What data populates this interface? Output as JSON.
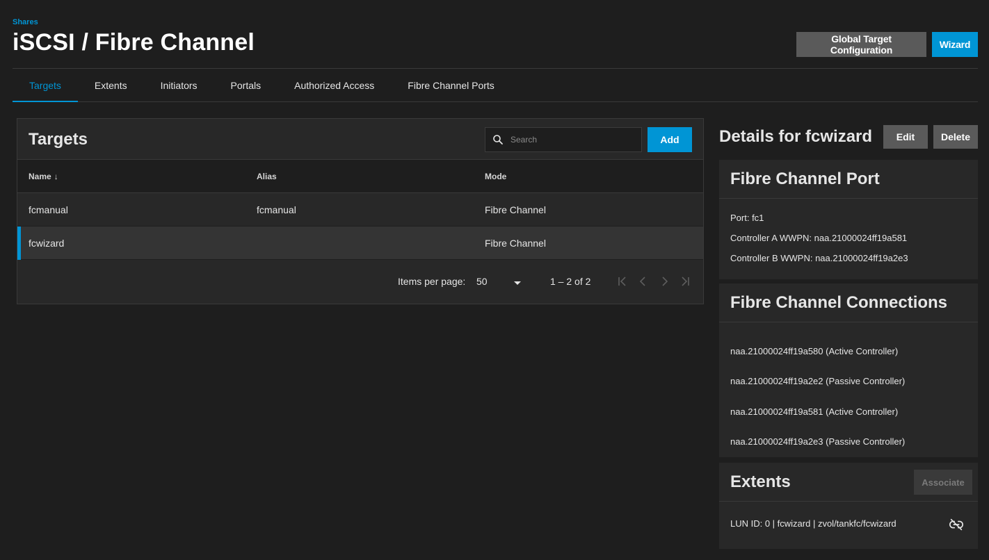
{
  "header": {
    "breadcrumb": "Shares",
    "title": "iSCSI / Fibre Channel",
    "global_target_label": "Global Target Configuration",
    "wizard_label": "Wizard"
  },
  "tabs": [
    {
      "label": "Targets",
      "active": true
    },
    {
      "label": "Extents"
    },
    {
      "label": "Initiators"
    },
    {
      "label": "Portals"
    },
    {
      "label": "Authorized Access"
    },
    {
      "label": "Fibre Channel Ports"
    }
  ],
  "targets_card": {
    "title": "Targets",
    "search_placeholder": "Search",
    "add_label": "Add",
    "columns": [
      "Name",
      "Alias",
      "Mode"
    ],
    "rows": [
      {
        "name": "fcmanual",
        "alias": "fcmanual",
        "mode": "Fibre Channel"
      },
      {
        "name": "fcwizard",
        "alias": "",
        "mode": "Fibre Channel",
        "selected": true
      }
    ],
    "paginator": {
      "items_per_page_label": "Items per page:",
      "page_size": "50",
      "range": "1 – 2 of 2"
    }
  },
  "details": {
    "title": "Details for fcwizard",
    "edit_label": "Edit",
    "delete_label": "Delete",
    "fc_port": {
      "title": "Fibre Channel Port",
      "lines": [
        "Port: fc1",
        "Controller A WWPN: naa.21000024ff19a581",
        "Controller B WWPN: naa.21000024ff19a2e3"
      ]
    },
    "fc_connections": {
      "title": "Fibre Channel Connections",
      "lines": [
        "naa.21000024ff19a580 (Active Controller)",
        "naa.21000024ff19a2e2 (Passive Controller)",
        "naa.21000024ff19a581 (Active Controller)",
        "naa.21000024ff19a2e3 (Passive Controller)"
      ]
    },
    "extents": {
      "title": "Extents",
      "associate_label": "Associate",
      "item": "LUN ID: 0 | fcwizard | zvol/tankfc/fcwizard"
    }
  },
  "colors": {
    "accent": "#0095d5",
    "background": "#1e1e1e",
    "card": "#282828",
    "button_secondary": "#5a5a5a"
  },
  "icons": [
    "search-icon",
    "sort-arrow-down-icon",
    "dropdown-caret-icon",
    "first-page-icon",
    "previous-page-icon",
    "next-page-icon",
    "last-page-icon",
    "unlink-icon"
  ]
}
